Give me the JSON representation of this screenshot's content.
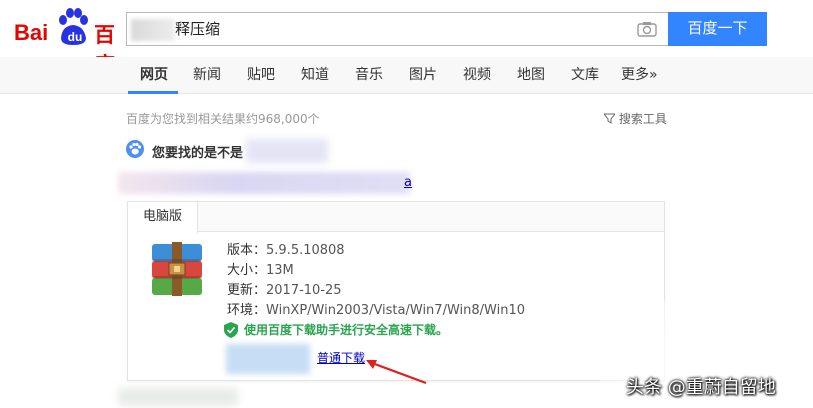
{
  "brand": {
    "logo_bai": "Bai",
    "logo_du": "du",
    "logo_cn": "百度"
  },
  "search": {
    "query_visible": "释压缩",
    "button_label": "百度一下"
  },
  "nav": {
    "tabs": [
      {
        "label": "网页",
        "active": true
      },
      {
        "label": "新闻"
      },
      {
        "label": "贴吧"
      },
      {
        "label": "知道"
      },
      {
        "label": "音乐"
      },
      {
        "label": "图片"
      },
      {
        "label": "视频"
      },
      {
        "label": "地图"
      },
      {
        "label": "文库"
      },
      {
        "label": "更多»"
      }
    ]
  },
  "results": {
    "count_text": "百度为您找到相关结果约968,000个",
    "tools_label": "搜索工具",
    "suggest_label": "您要找的是不是",
    "title_end": "a"
  },
  "card": {
    "tab_label": "电脑版",
    "info": [
      {
        "label": "版本：",
        "value": "5.9.5.10808"
      },
      {
        "label": "大小：",
        "value": "13M"
      },
      {
        "label": "更新：",
        "value": "2017-10-25"
      },
      {
        "label": "环境：",
        "value": "WinXP/Win2003/Vista/Win7/Win8/Win10"
      }
    ],
    "safe_text": "使用百度下载助手进行安全高速下载。",
    "normal_download": "普通下载"
  },
  "watermark": "头条 @重蔚自留地",
  "colors": {
    "brand_red": "#e10602",
    "button_blue": "#3385ff",
    "link_blue": "#0000cc",
    "safe_green": "#2aa44f",
    "arrow_red": "#e02020"
  }
}
